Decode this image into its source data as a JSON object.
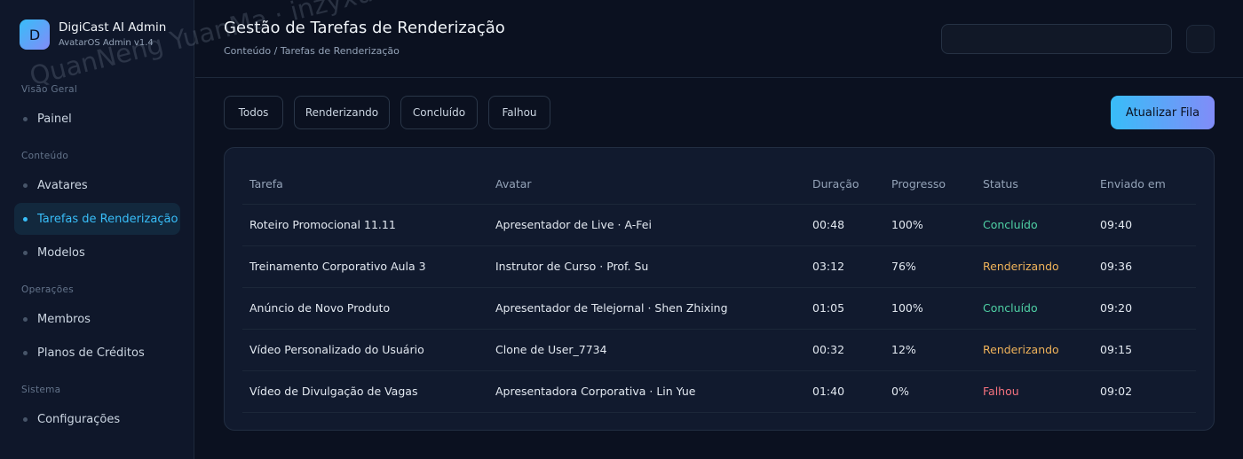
{
  "brand": {
    "logo_letter": "D",
    "title": "DigiCast AI Admin",
    "subtitle": "AvatarOS Admin v1.4"
  },
  "sidebar": {
    "sections": [
      {
        "label": "Visão Geral",
        "items": [
          {
            "label": "Painel",
            "active": false
          }
        ]
      },
      {
        "label": "Conteúdo",
        "items": [
          {
            "label": "Avatares",
            "active": false
          },
          {
            "label": "Tarefas de Renderização",
            "active": true
          },
          {
            "label": "Modelos",
            "active": false
          }
        ]
      },
      {
        "label": "Operações",
        "items": [
          {
            "label": "Membros",
            "active": false
          },
          {
            "label": "Planos de Créditos",
            "active": false
          }
        ]
      },
      {
        "label": "Sistema",
        "items": [
          {
            "label": "Configurações",
            "active": false
          }
        ]
      }
    ]
  },
  "header": {
    "title": "Gestão de Tarefas de Renderização",
    "breadcrumb": "Conteúdo / Tarefas de Renderização",
    "search_value": ""
  },
  "filters": [
    "Todos",
    "Renderizando",
    "Concluído",
    "Falhou"
  ],
  "refresh_label": "Atualizar Fila",
  "table": {
    "columns": [
      "Tarefa",
      "Avatar",
      "Duração",
      "Progresso",
      "Status",
      "Enviado em"
    ],
    "rows": [
      {
        "task": "Roteiro Promocional 11.11",
        "avatar": "Apresentador de Live · A-Fei",
        "duration": "00:48",
        "progress": "100%",
        "status": "Concluído",
        "sent": "09:40"
      },
      {
        "task": "Treinamento Corporativo Aula 3",
        "avatar": "Instrutor de Curso · Prof. Su",
        "duration": "03:12",
        "progress": "76%",
        "status": "Renderizando",
        "sent": "09:36"
      },
      {
        "task": "Anúncio de Novo Produto",
        "avatar": "Apresentador de Telejornal · Shen Zhixing",
        "duration": "01:05",
        "progress": "100%",
        "status": "Concluído",
        "sent": "09:20"
      },
      {
        "task": "Vídeo Personalizado do Usuário",
        "avatar": "Clone de User_7734",
        "duration": "00:32",
        "progress": "12%",
        "status": "Renderizando",
        "sent": "09:15"
      },
      {
        "task": "Vídeo de Divulgação de Vagas",
        "avatar": "Apresentadora Corporativa · Lin Yue",
        "duration": "01:40",
        "progress": "0%",
        "status": "Falhou",
        "sent": "09:02"
      }
    ]
  },
  "status_colors": {
    "Concluído": "#4fd1a5",
    "Renderizando": "#f0b35a",
    "Falhou": "#f4727e"
  },
  "accent_color": "#38bdf8",
  "watermark": "QuanNeng YuanMa · inzyxuashop.com"
}
